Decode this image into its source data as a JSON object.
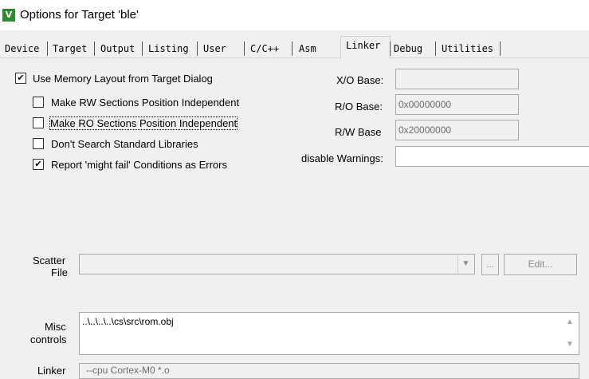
{
  "window": {
    "title": "Options for Target 'ble'",
    "icon": "keil-uvision-icon"
  },
  "tabs": [
    {
      "label": "Device"
    },
    {
      "label": "Target"
    },
    {
      "label": "Output"
    },
    {
      "label": "Listing"
    },
    {
      "label": "User"
    },
    {
      "label": "C/C++"
    },
    {
      "label": "Asm"
    },
    {
      "label": "Linker"
    },
    {
      "label": "Debug"
    },
    {
      "label": "Utilities"
    }
  ],
  "active_tab": "Linker",
  "options": {
    "use_memory_layout": {
      "label": "Use Memory Layout from Target Dialog",
      "checked": true
    },
    "rw_independent": {
      "label": "Make RW Sections Position Independent",
      "checked": false
    },
    "ro_independent": {
      "label": "Make RO Sections Position Independent",
      "checked": false
    },
    "dont_search_libs": {
      "label": "Don't Search Standard Libraries",
      "checked": false
    },
    "might_fail_errors": {
      "label": "Report 'might fail' Conditions as Errors",
      "checked": true
    }
  },
  "bases": {
    "xo_label": "X/O Base:",
    "xo_value": "",
    "ro_label": "R/O Base:",
    "ro_value": "0x00000000",
    "rw_label": "R/W Base",
    "rw_value": "0x20000000",
    "warnings_label": "disable Warnings:",
    "warnings_value": ""
  },
  "scatter": {
    "label_line1": "Scatter",
    "label_line2": "File",
    "value": "",
    "browse_label": "...",
    "edit_label": "Edit..."
  },
  "misc": {
    "label_line1": "Misc",
    "label_line2": "controls",
    "value": "..\\..\\..\\..\\cs\\src\\rom.obj"
  },
  "linker_control": {
    "label": "Linker",
    "value": "--cpu Cortex-M0 *.o"
  },
  "checkmark": "✔"
}
